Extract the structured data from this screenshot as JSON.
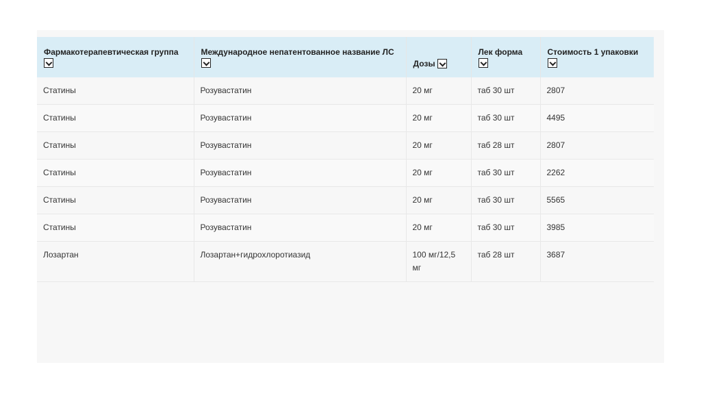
{
  "table": {
    "headers": [
      "Фармакотерапевтическая группа",
      "Международное непатентованное название ЛС",
      "Дозы",
      "Лек форма",
      "Стоимость 1 упаковки"
    ],
    "rows": [
      [
        "Статины",
        "Розувастатин",
        "20 мг",
        "таб 30 шт",
        "2807"
      ],
      [
        "Статины",
        "Розувастатин",
        "20 мг",
        "таб 30 шт",
        "4495"
      ],
      [
        "Статины",
        "Розувастатин",
        "20 мг",
        "таб 28 шт",
        "2807"
      ],
      [
        "Статины",
        "Розувастатин",
        "20 мг",
        "таб 30 шт",
        "2262"
      ],
      [
        "Статины",
        "Розувастатин",
        "20 мг",
        "таб 30 шт",
        "5565"
      ],
      [
        "Статины",
        "Розувастатин",
        "20 мг",
        "таб 30 шт",
        "3985"
      ],
      [
        "Лозартан",
        "Лозартан+гидрохлоротиазид",
        "100 мг/12,5 мг",
        "таб 28 шт",
        "3687"
      ]
    ]
  },
  "icons": {
    "sort": "chevron-down-icon"
  },
  "colors": {
    "header_bg": "#d9edf6",
    "page_bg": "#f7f7f7"
  }
}
